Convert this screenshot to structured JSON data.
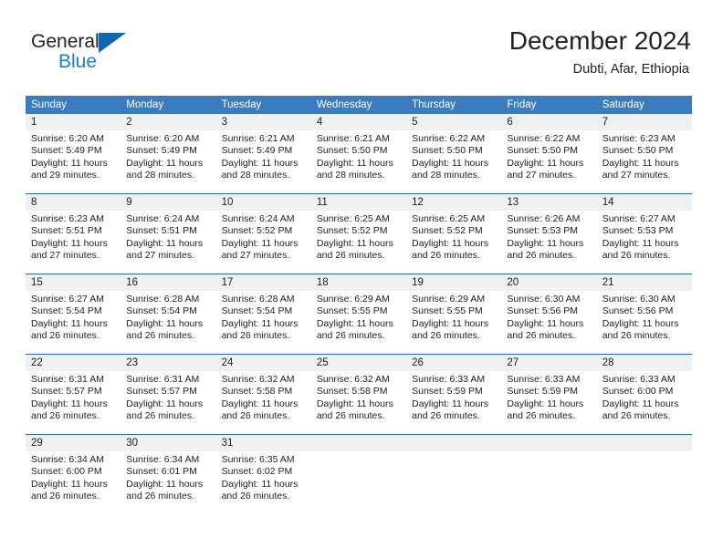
{
  "brand": {
    "name_part1": "General",
    "name_part2": "Blue",
    "triangle_color": "#1266ad",
    "part2_color": "#1b7fd4"
  },
  "header": {
    "title": "December 2024",
    "subtitle": "Dubti, Afar, Ethiopia"
  },
  "colors": {
    "header_blue": "#3b7cbf",
    "row_divider_blue": "#2a6aad",
    "day_number_band": "#f0f0f0",
    "text": "#222222"
  },
  "weekdays": [
    "Sunday",
    "Monday",
    "Tuesday",
    "Wednesday",
    "Thursday",
    "Friday",
    "Saturday"
  ],
  "weeks": [
    [
      {
        "day": "1",
        "sunrise": "Sunrise: 6:20 AM",
        "sunset": "Sunset: 5:49 PM",
        "daylight1": "Daylight: 11 hours",
        "daylight2": "and 29 minutes."
      },
      {
        "day": "2",
        "sunrise": "Sunrise: 6:20 AM",
        "sunset": "Sunset: 5:49 PM",
        "daylight1": "Daylight: 11 hours",
        "daylight2": "and 28 minutes."
      },
      {
        "day": "3",
        "sunrise": "Sunrise: 6:21 AM",
        "sunset": "Sunset: 5:49 PM",
        "daylight1": "Daylight: 11 hours",
        "daylight2": "and 28 minutes."
      },
      {
        "day": "4",
        "sunrise": "Sunrise: 6:21 AM",
        "sunset": "Sunset: 5:50 PM",
        "daylight1": "Daylight: 11 hours",
        "daylight2": "and 28 minutes."
      },
      {
        "day": "5",
        "sunrise": "Sunrise: 6:22 AM",
        "sunset": "Sunset: 5:50 PM",
        "daylight1": "Daylight: 11 hours",
        "daylight2": "and 28 minutes."
      },
      {
        "day": "6",
        "sunrise": "Sunrise: 6:22 AM",
        "sunset": "Sunset: 5:50 PM",
        "daylight1": "Daylight: 11 hours",
        "daylight2": "and 27 minutes."
      },
      {
        "day": "7",
        "sunrise": "Sunrise: 6:23 AM",
        "sunset": "Sunset: 5:50 PM",
        "daylight1": "Daylight: 11 hours",
        "daylight2": "and 27 minutes."
      }
    ],
    [
      {
        "day": "8",
        "sunrise": "Sunrise: 6:23 AM",
        "sunset": "Sunset: 5:51 PM",
        "daylight1": "Daylight: 11 hours",
        "daylight2": "and 27 minutes."
      },
      {
        "day": "9",
        "sunrise": "Sunrise: 6:24 AM",
        "sunset": "Sunset: 5:51 PM",
        "daylight1": "Daylight: 11 hours",
        "daylight2": "and 27 minutes."
      },
      {
        "day": "10",
        "sunrise": "Sunrise: 6:24 AM",
        "sunset": "Sunset: 5:52 PM",
        "daylight1": "Daylight: 11 hours",
        "daylight2": "and 27 minutes."
      },
      {
        "day": "11",
        "sunrise": "Sunrise: 6:25 AM",
        "sunset": "Sunset: 5:52 PM",
        "daylight1": "Daylight: 11 hours",
        "daylight2": "and 26 minutes."
      },
      {
        "day": "12",
        "sunrise": "Sunrise: 6:25 AM",
        "sunset": "Sunset: 5:52 PM",
        "daylight1": "Daylight: 11 hours",
        "daylight2": "and 26 minutes."
      },
      {
        "day": "13",
        "sunrise": "Sunrise: 6:26 AM",
        "sunset": "Sunset: 5:53 PM",
        "daylight1": "Daylight: 11 hours",
        "daylight2": "and 26 minutes."
      },
      {
        "day": "14",
        "sunrise": "Sunrise: 6:27 AM",
        "sunset": "Sunset: 5:53 PM",
        "daylight1": "Daylight: 11 hours",
        "daylight2": "and 26 minutes."
      }
    ],
    [
      {
        "day": "15",
        "sunrise": "Sunrise: 6:27 AM",
        "sunset": "Sunset: 5:54 PM",
        "daylight1": "Daylight: 11 hours",
        "daylight2": "and 26 minutes."
      },
      {
        "day": "16",
        "sunrise": "Sunrise: 6:28 AM",
        "sunset": "Sunset: 5:54 PM",
        "daylight1": "Daylight: 11 hours",
        "daylight2": "and 26 minutes."
      },
      {
        "day": "17",
        "sunrise": "Sunrise: 6:28 AM",
        "sunset": "Sunset: 5:54 PM",
        "daylight1": "Daylight: 11 hours",
        "daylight2": "and 26 minutes."
      },
      {
        "day": "18",
        "sunrise": "Sunrise: 6:29 AM",
        "sunset": "Sunset: 5:55 PM",
        "daylight1": "Daylight: 11 hours",
        "daylight2": "and 26 minutes."
      },
      {
        "day": "19",
        "sunrise": "Sunrise: 6:29 AM",
        "sunset": "Sunset: 5:55 PM",
        "daylight1": "Daylight: 11 hours",
        "daylight2": "and 26 minutes."
      },
      {
        "day": "20",
        "sunrise": "Sunrise: 6:30 AM",
        "sunset": "Sunset: 5:56 PM",
        "daylight1": "Daylight: 11 hours",
        "daylight2": "and 26 minutes."
      },
      {
        "day": "21",
        "sunrise": "Sunrise: 6:30 AM",
        "sunset": "Sunset: 5:56 PM",
        "daylight1": "Daylight: 11 hours",
        "daylight2": "and 26 minutes."
      }
    ],
    [
      {
        "day": "22",
        "sunrise": "Sunrise: 6:31 AM",
        "sunset": "Sunset: 5:57 PM",
        "daylight1": "Daylight: 11 hours",
        "daylight2": "and 26 minutes."
      },
      {
        "day": "23",
        "sunrise": "Sunrise: 6:31 AM",
        "sunset": "Sunset: 5:57 PM",
        "daylight1": "Daylight: 11 hours",
        "daylight2": "and 26 minutes."
      },
      {
        "day": "24",
        "sunrise": "Sunrise: 6:32 AM",
        "sunset": "Sunset: 5:58 PM",
        "daylight1": "Daylight: 11 hours",
        "daylight2": "and 26 minutes."
      },
      {
        "day": "25",
        "sunrise": "Sunrise: 6:32 AM",
        "sunset": "Sunset: 5:58 PM",
        "daylight1": "Daylight: 11 hours",
        "daylight2": "and 26 minutes."
      },
      {
        "day": "26",
        "sunrise": "Sunrise: 6:33 AM",
        "sunset": "Sunset: 5:59 PM",
        "daylight1": "Daylight: 11 hours",
        "daylight2": "and 26 minutes."
      },
      {
        "day": "27",
        "sunrise": "Sunrise: 6:33 AM",
        "sunset": "Sunset: 5:59 PM",
        "daylight1": "Daylight: 11 hours",
        "daylight2": "and 26 minutes."
      },
      {
        "day": "28",
        "sunrise": "Sunrise: 6:33 AM",
        "sunset": "Sunset: 6:00 PM",
        "daylight1": "Daylight: 11 hours",
        "daylight2": "and 26 minutes."
      }
    ],
    [
      {
        "day": "29",
        "sunrise": "Sunrise: 6:34 AM",
        "sunset": "Sunset: 6:00 PM",
        "daylight1": "Daylight: 11 hours",
        "daylight2": "and 26 minutes."
      },
      {
        "day": "30",
        "sunrise": "Sunrise: 6:34 AM",
        "sunset": "Sunset: 6:01 PM",
        "daylight1": "Daylight: 11 hours",
        "daylight2": "and 26 minutes."
      },
      {
        "day": "31",
        "sunrise": "Sunrise: 6:35 AM",
        "sunset": "Sunset: 6:02 PM",
        "daylight1": "Daylight: 11 hours",
        "daylight2": "and 26 minutes."
      },
      {
        "day": "",
        "sunrise": "",
        "sunset": "",
        "daylight1": "",
        "daylight2": ""
      },
      {
        "day": "",
        "sunrise": "",
        "sunset": "",
        "daylight1": "",
        "daylight2": ""
      },
      {
        "day": "",
        "sunrise": "",
        "sunset": "",
        "daylight1": "",
        "daylight2": ""
      },
      {
        "day": "",
        "sunrise": "",
        "sunset": "",
        "daylight1": "",
        "daylight2": ""
      }
    ]
  ]
}
